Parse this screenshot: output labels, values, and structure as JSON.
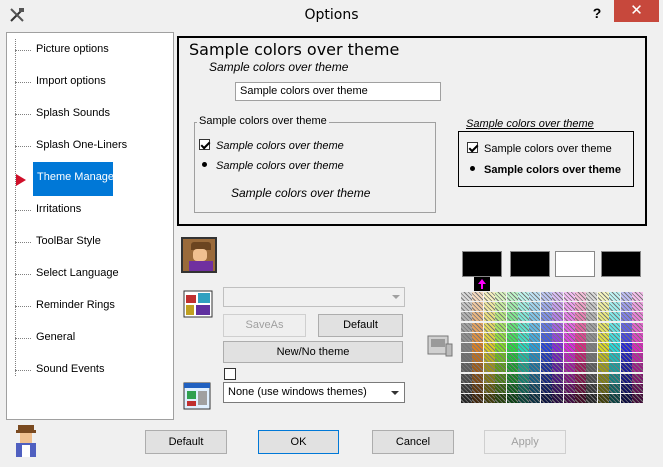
{
  "window": {
    "title": "Options",
    "help_label": "?",
    "close_label": "✕"
  },
  "sidebar": {
    "items": [
      {
        "label": "Picture options"
      },
      {
        "label": "Import options"
      },
      {
        "label": "Splash Sounds"
      },
      {
        "label": "Splash One-Liners"
      },
      {
        "label": "Theme Manager",
        "selected": true
      },
      {
        "label": "Irritations"
      },
      {
        "label": "ToolBar Style"
      },
      {
        "label": "Select Language"
      },
      {
        "label": "Reminder Rings"
      },
      {
        "label": "General"
      },
      {
        "label": "Sound Events"
      }
    ]
  },
  "preview": {
    "heading": "Sample colors over theme",
    "italic_caption": "Sample colors over theme",
    "input_value": "Sample colors over theme",
    "group_legend": "Sample colors over theme",
    "checkbox_label": "Sample colors over theme",
    "radio_label": "Sample colors over theme",
    "group_caption": "Sample colors over theme",
    "group2_legend": "Sample colors over theme",
    "group2_checkbox_label": "Sample colors over theme",
    "group2_radio_label": "Sample colors over theme"
  },
  "theme": {
    "saveas_label": "SaveAs",
    "default_label": "Default",
    "new_no_theme_label": "New/No theme",
    "select_value": "None (use windows themes)"
  },
  "swatches": {
    "colors": [
      "#000000",
      "#000000",
      "#ffffff",
      "#000000"
    ]
  },
  "footer": {
    "default_label": "Default",
    "ok_label": "OK",
    "cancel_label": "Cancel",
    "apply_label": "Apply"
  },
  "colors": {
    "accent": "#0078d7",
    "marker": "#d0102a",
    "close": "#c7483c"
  }
}
